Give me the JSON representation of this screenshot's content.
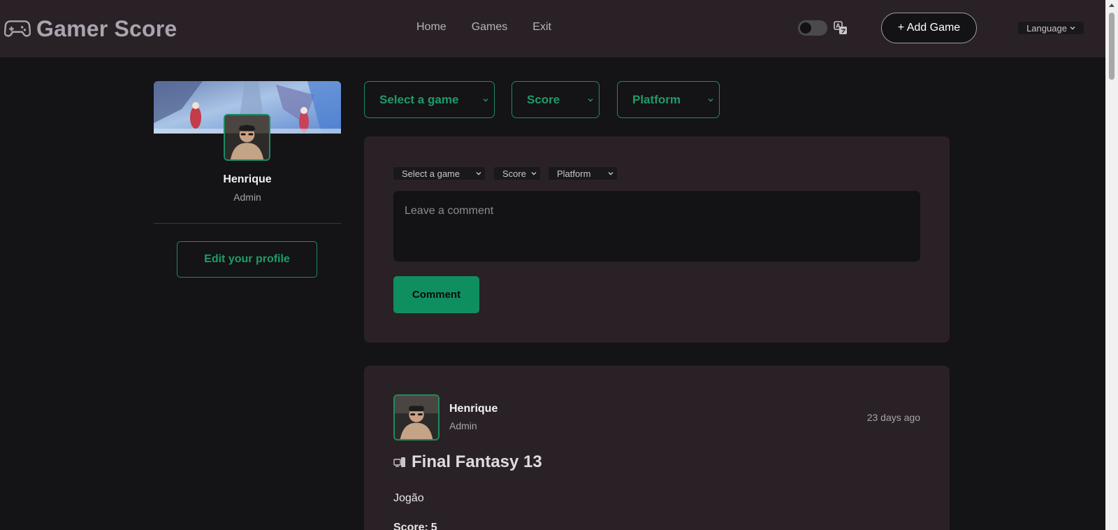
{
  "app": {
    "title": "Gamer Score"
  },
  "nav": {
    "items": [
      "Home",
      "Games",
      "Exit"
    ]
  },
  "header": {
    "add_game_label": "+ Add Game",
    "language_label": "Language",
    "theme_toggle": "off"
  },
  "profile": {
    "name": "Henrique",
    "role": "Admin",
    "edit_label": "Edit your profile"
  },
  "filters": {
    "game": "Select a game",
    "score": "Score",
    "platform": "Platform"
  },
  "composer": {
    "game": "Select a game",
    "score": "Score",
    "platform": "Platform",
    "placeholder": "Leave a comment",
    "submit_label": "Comment"
  },
  "post": {
    "author": "Henrique",
    "role": "Admin",
    "time": "23 days ago",
    "platform_icon": "device-icon",
    "game_title": "Final Fantasy 13",
    "body": "Jogão",
    "score_label": "Score:",
    "score_value": "5"
  },
  "colors": {
    "accent": "#1e8c60",
    "button": "#0f8f60",
    "card": "#2a2126",
    "background": "#141316"
  }
}
